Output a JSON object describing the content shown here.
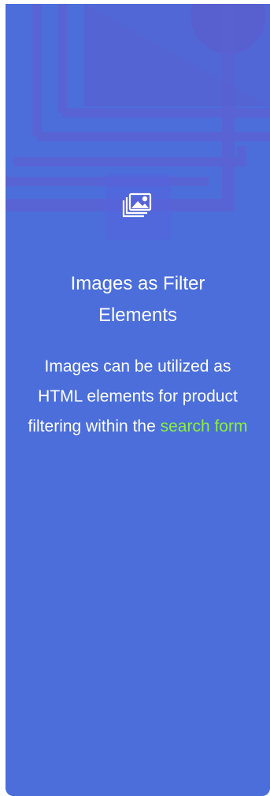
{
  "feature": {
    "title_line1": "Images as Filter",
    "title_line2": "Elements",
    "description": "Images can be utilized as HTML elements for product filtering within the",
    "link_text": "search form"
  },
  "colors": {
    "card_background": "#4b6edb",
    "link": "#8af03d",
    "text": "#ffffff"
  },
  "icon": "images-stack-icon"
}
